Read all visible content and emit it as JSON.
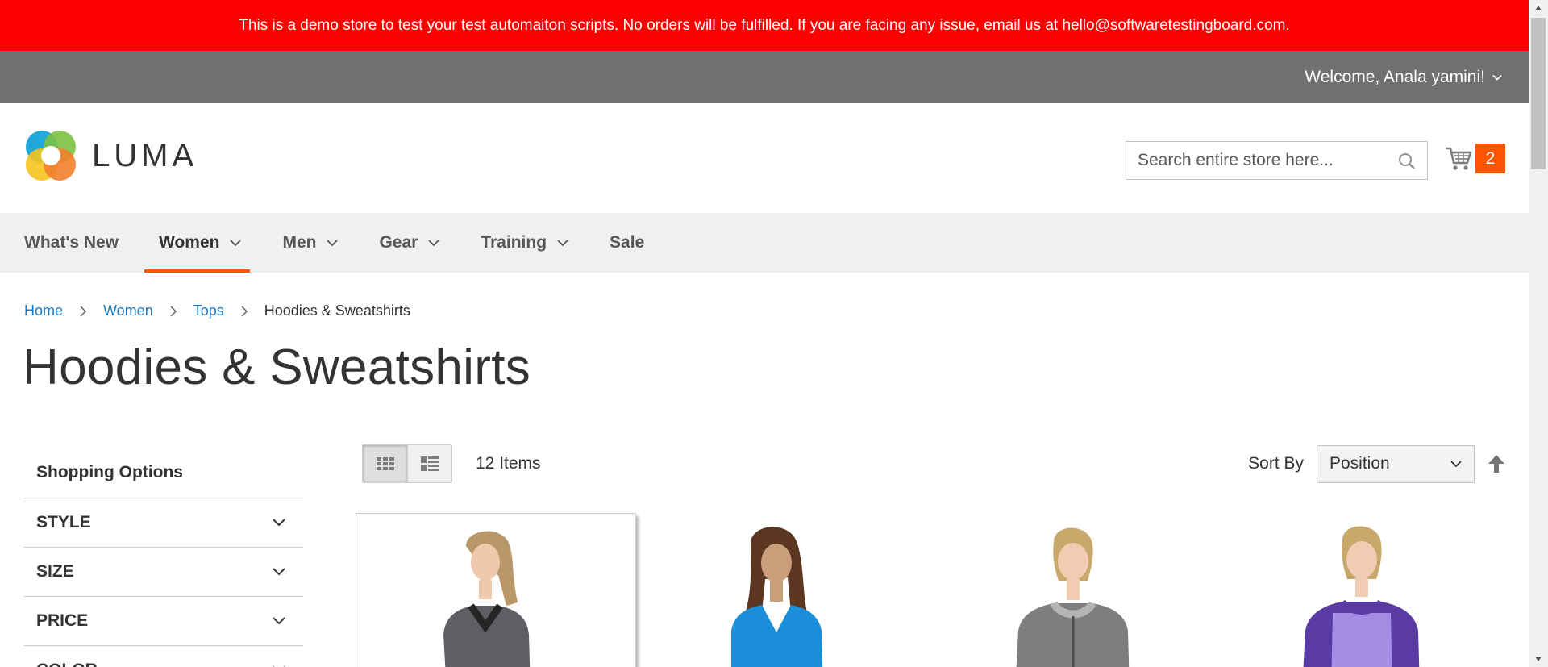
{
  "notice": {
    "text": "This is a demo store to test your test automaiton scripts. No orders will be fulfilled. If you are facing any issue, email us at hello@softwaretestingboard.com."
  },
  "panel": {
    "welcome": "Welcome, Anala yamini!"
  },
  "header": {
    "logo_text": "LUMA",
    "search_placeholder": "Search entire store here...",
    "cart_count": "2"
  },
  "nav": {
    "items": [
      {
        "label": "What's New",
        "active": false,
        "dropdown": false
      },
      {
        "label": "Women",
        "active": true,
        "dropdown": true
      },
      {
        "label": "Men",
        "active": false,
        "dropdown": true
      },
      {
        "label": "Gear",
        "active": false,
        "dropdown": true
      },
      {
        "label": "Training",
        "active": false,
        "dropdown": true
      },
      {
        "label": "Sale",
        "active": false,
        "dropdown": false
      }
    ]
  },
  "breadcrumbs": {
    "items": [
      "Home",
      "Women",
      "Tops"
    ],
    "current": "Hoodies & Sweatshirts"
  },
  "page": {
    "title": "Hoodies & Sweatshirts"
  },
  "sidebar": {
    "title": "Shopping Options",
    "filters": [
      "STYLE",
      "SIZE",
      "PRICE",
      "COLOR"
    ]
  },
  "toolbar": {
    "amount": "12 Items",
    "sort_label": "Sort By",
    "sort_value": "Position",
    "view_modes": [
      "grid",
      "list"
    ],
    "active_mode": "grid"
  },
  "products": [
    {
      "image": "woman-gray-black-hoodie",
      "hover": true
    },
    {
      "image": "woman-blue-vneck-top",
      "hover": false
    },
    {
      "image": "woman-gray-zip-hoodie",
      "hover": false
    },
    {
      "image": "woman-purple-raglan-hoodie",
      "hover": false
    }
  ],
  "colors": {
    "notice_bg": "#ff0000",
    "panel_bg": "#6e716e",
    "nav_bg": "#f0f0f0",
    "accent": "#ff5501",
    "link": "#1979c3"
  }
}
